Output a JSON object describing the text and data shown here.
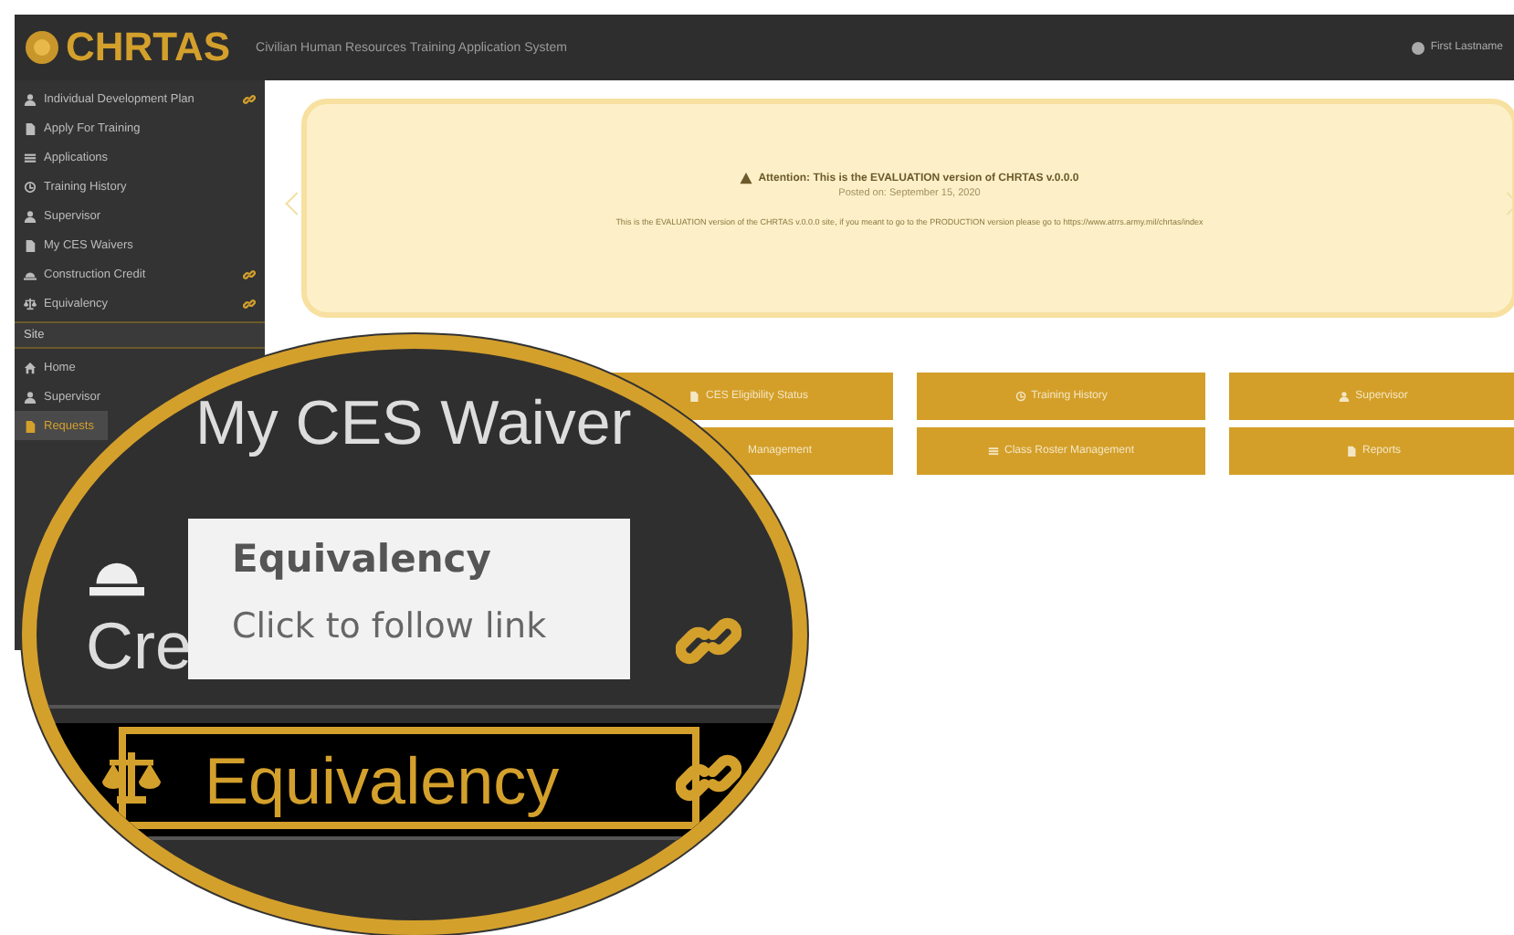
{
  "header": {
    "logo": "CHRTAS",
    "subtitle": "Civilian Human Resources Training Application System",
    "user": "First Lastname"
  },
  "sidebar": {
    "items": [
      {
        "label": "Individual Development Plan",
        "kind": "person",
        "link": true,
        "selected": false
      },
      {
        "label": "Apply For Training",
        "kind": "document",
        "link": false,
        "selected": false
      },
      {
        "label": "Applications",
        "kind": "list",
        "link": false,
        "selected": false
      },
      {
        "label": "Training History",
        "kind": "clock",
        "link": false,
        "selected": false
      },
      {
        "label": "Supervisor",
        "kind": "person",
        "link": false,
        "selected": false
      },
      {
        "label": "My CES Waivers",
        "kind": "document",
        "link": false,
        "selected": false
      },
      {
        "label": "Construction Credit",
        "kind": "helmet",
        "link": true,
        "selected": false
      },
      {
        "label": "Equivalency",
        "kind": "scale",
        "link": true,
        "selected": false
      }
    ],
    "section": "Site",
    "site_items": [
      {
        "label": "Home",
        "kind": "home",
        "selected": false
      },
      {
        "label": "Supervisor",
        "kind": "person",
        "selected": false
      },
      {
        "label": "Requests",
        "kind": "document",
        "selected": true
      }
    ]
  },
  "banner": {
    "title": "Attention: This is the EVALUATION version of CHRTAS v.0.0.0",
    "posted": "Posted on: September 15, 2020",
    "text": "This is the EVALUATION version of the CHRTAS v.0.0.0 site, if you meant to go to the PRODUCTION version please go to https://www.atrrs.army.mil/chrtas/index"
  },
  "tiles": [
    {
      "label": "CES Eligibility Status",
      "kind": "document"
    },
    {
      "label": "Training History",
      "kind": "clock"
    },
    {
      "label": "Supervisor",
      "kind": "person"
    },
    {
      "label": "Management"
    },
    {
      "label": "Class Roster Management",
      "kind": "list"
    },
    {
      "label": "Reports",
      "kind": "document"
    }
  ],
  "magnifier": {
    "heading": "My CES Waiver",
    "rows": [
      {
        "label": "Cre",
        "kind": "helmet",
        "link": true,
        "highlighted": false
      },
      {
        "label": "Equivalency",
        "kind": "scale",
        "link": true,
        "highlighted": true
      }
    ],
    "tooltip": {
      "title": "Equivalency",
      "text": "Click to follow link"
    }
  }
}
